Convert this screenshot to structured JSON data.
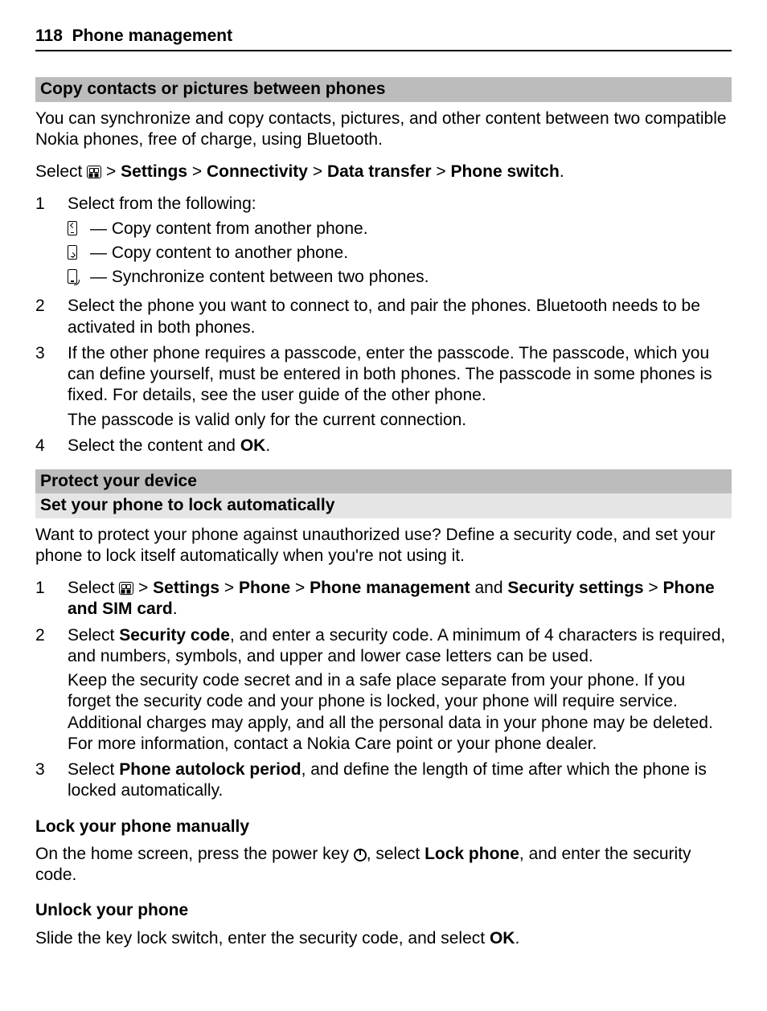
{
  "header": {
    "page_no": "118",
    "title": "Phone management"
  },
  "s1": {
    "bar": "Copy contacts or pictures between phones",
    "intro": "You can synchronize and copy contacts, pictures, and other content between two compatible Nokia phones, free of charge, using Bluetooth.",
    "select_lead": "Select ",
    "path_sep": " > ",
    "p1": "Settings",
    "p2": "Connectivity",
    "p3": "Data transfer",
    "p4": "Phone switch",
    "step1": "Select from the following:",
    "opt1": " — Copy content from another phone.",
    "opt2": " — Copy content to another phone.",
    "opt3": " — Synchronize content between two phones.",
    "step2": "Select the phone you want to connect to, and pair the phones. Bluetooth needs to be activated in both phones.",
    "step3": "If the other phone requires a passcode, enter the passcode. The passcode, which you can define yourself, must be entered in both phones. The passcode in some phones is fixed. For details, see the user guide of the other phone.",
    "step3b": "The passcode is valid only for the current connection.",
    "step4a": "Select the content and ",
    "step4b": "OK",
    "step4c": "."
  },
  "s2": {
    "bar": "Protect your device",
    "sub": "Set your phone to lock automatically",
    "intro": "Want to protect your phone against unauthorized use? Define a security code, and set your phone to lock itself automatically when you're not using it.",
    "st1_a": "Select ",
    "st1_p1": "Settings",
    "st1_p2": "Phone",
    "st1_p3": "Phone management",
    "st1_and": " and ",
    "st1_p4": "Security settings",
    "st1_sep": " > ",
    "st1_p5": "Phone and SIM card",
    "st1_end": ".",
    "st2_a": "Select ",
    "st2_b": "Security code",
    "st2_c": ", and enter a security code. A minimum of 4 characters is required, and numbers, symbols, and upper and lower case letters can be used.",
    "st2_p2": "Keep the security code secret and in a safe place separate from your phone. If you forget the security code and your phone is locked, your phone will require service. Additional charges may apply, and all the personal data in your phone may be deleted. For more information, contact a Nokia Care point or your phone dealer.",
    "st3_a": "Select ",
    "st3_b": "Phone autolock period",
    "st3_c": ", and define the length of time after which the phone is locked automatically."
  },
  "s3": {
    "h": "Lock your phone manually",
    "a": "On the home screen, press the power key ",
    "b": ", select ",
    "c": "Lock phone",
    "d": ", and enter the security code."
  },
  "s4": {
    "h": "Unlock your phone",
    "a": "Slide the key lock switch, enter the security code, and select ",
    "b": "OK",
    "c": "."
  },
  "nums": {
    "n1": "1",
    "n2": "2",
    "n3": "3",
    "n4": "4"
  }
}
